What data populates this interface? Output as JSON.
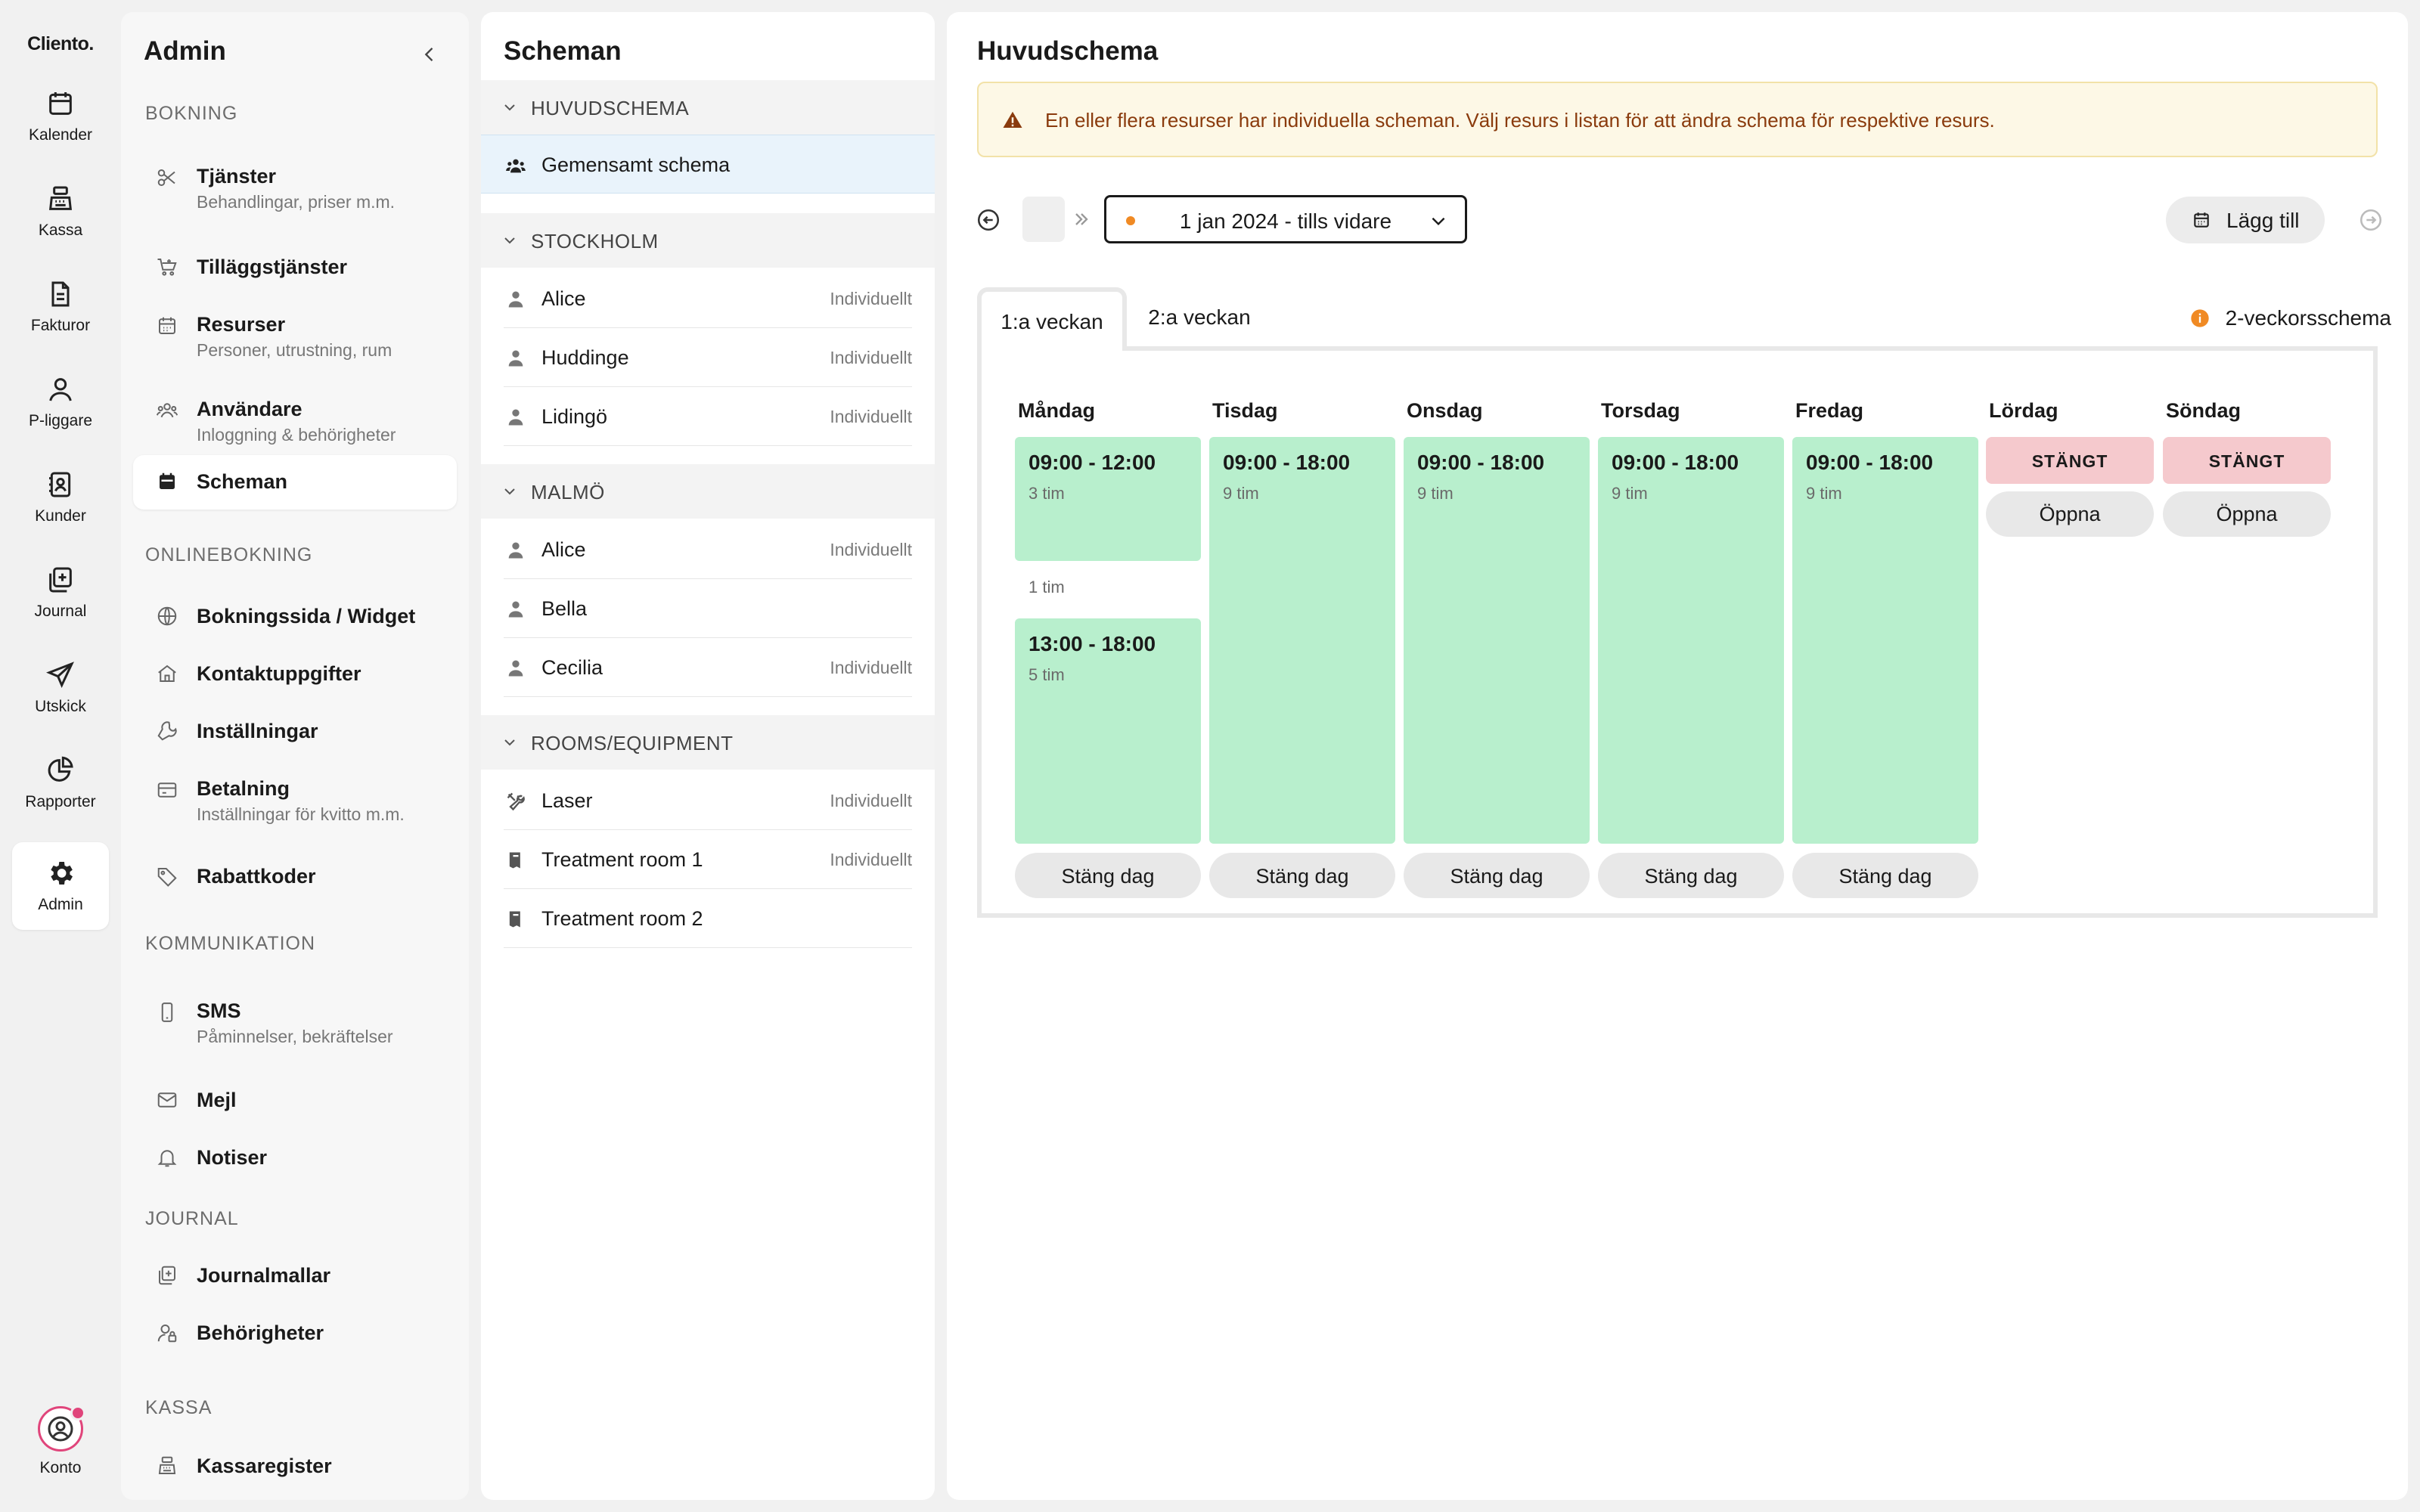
{
  "rail": {
    "logo": "Cliento.",
    "items": [
      {
        "label": "Kalender",
        "icon": "calendar-icon"
      },
      {
        "label": "Kassa",
        "icon": "cash-register-icon"
      },
      {
        "label": "Fakturor",
        "icon": "invoice-icon"
      },
      {
        "label": "P-liggare",
        "icon": "person-icon"
      },
      {
        "label": "Kunder",
        "icon": "contacts-icon"
      },
      {
        "label": "Journal",
        "icon": "journal-icon"
      },
      {
        "label": "Utskick",
        "icon": "send-icon"
      },
      {
        "label": "Rapporter",
        "icon": "pie-chart-icon"
      },
      {
        "label": "Admin",
        "icon": "gear-icon",
        "active": true
      }
    ],
    "account_label": "Konto"
  },
  "admin": {
    "title": "Admin",
    "sections": {
      "bokning": "BOKNING",
      "onlinebokning": "ONLINEBOKNING",
      "kommunikation": "KOMMUNIKATION",
      "journal": "JOURNAL",
      "kassa": "KASSA"
    },
    "items": {
      "tjanster": {
        "label": "Tjänster",
        "sub": "Behandlingar, priser m.m."
      },
      "tillagg": {
        "label": "Tilläggstjänster"
      },
      "resurser": {
        "label": "Resurser",
        "sub": "Personer, utrustning, rum"
      },
      "anvandare": {
        "label": "Användare",
        "sub": "Inloggning & behörigheter"
      },
      "scheman": {
        "label": "Scheman"
      },
      "bokningssida": {
        "label": "Bokningssida / Widget"
      },
      "kontakt": {
        "label": "Kontaktuppgifter"
      },
      "installningar": {
        "label": "Inställningar"
      },
      "betalning": {
        "label": "Betalning",
        "sub": "Inställningar för kvitto m.m."
      },
      "rabatt": {
        "label": "Rabattkoder"
      },
      "sms": {
        "label": "SMS",
        "sub": "Påminnelser, bekräftelser"
      },
      "mejl": {
        "label": "Mejl"
      },
      "notiser": {
        "label": "Notiser"
      },
      "journalmallar": {
        "label": "Journalmallar"
      },
      "behorigheter": {
        "label": "Behörigheter"
      },
      "kassaregister": {
        "label": "Kassaregister"
      }
    }
  },
  "scheman": {
    "title": "Scheman",
    "groups": [
      {
        "name": "HUVUDSCHEMA",
        "rows": [
          {
            "label": "Gemensamt schema",
            "tag": ""
          }
        ]
      },
      {
        "name": "STOCKHOLM",
        "rows": [
          {
            "label": "Alice",
            "tag": "Individuellt"
          },
          {
            "label": "Huddinge",
            "tag": "Individuellt"
          },
          {
            "label": "Lidingö",
            "tag": "Individuellt"
          }
        ]
      },
      {
        "name": "MALMÖ",
        "rows": [
          {
            "label": "Alice",
            "tag": "Individuellt"
          },
          {
            "label": "Bella",
            "tag": ""
          },
          {
            "label": "Cecilia",
            "tag": "Individuellt"
          }
        ]
      },
      {
        "name": "ROOMS/EQUIPMENT",
        "rows": [
          {
            "label": "Laser",
            "tag": "Individuellt"
          },
          {
            "label": "Treatment room 1",
            "tag": "Individuellt"
          },
          {
            "label": "Treatment room 2",
            "tag": ""
          }
        ]
      }
    ]
  },
  "main": {
    "title": "Huvudschema",
    "alert": "En eller flera resurser har individuella scheman. Välj resurs i listan för att ändra schema för respektive resurs.",
    "date_range": "1 jan 2024 - tills vidare",
    "add_label": "Lägg till",
    "tabs": [
      "1:a veckan",
      "2:a veckan"
    ],
    "biweek_label": "2-veckorsschema",
    "close_day_label": "Stäng dag",
    "closed_label": "STÄNGT",
    "open_label": "Öppna",
    "days": [
      {
        "name": "Måndag",
        "slots": [
          {
            "time": "09:00 - 12:00",
            "dur": "3 tim"
          },
          {
            "time": "13:00 - 18:00",
            "dur": "5 tim"
          }
        ],
        "gap": "1 tim"
      },
      {
        "name": "Tisdag",
        "slots": [
          {
            "time": "09:00 - 18:00",
            "dur": "9 tim"
          }
        ]
      },
      {
        "name": "Onsdag",
        "slots": [
          {
            "time": "09:00 - 18:00",
            "dur": "9 tim"
          }
        ]
      },
      {
        "name": "Torsdag",
        "slots": [
          {
            "time": "09:00 - 18:00",
            "dur": "9 tim"
          }
        ]
      },
      {
        "name": "Fredag",
        "slots": [
          {
            "time": "09:00 - 18:00",
            "dur": "9 tim"
          }
        ]
      },
      {
        "name": "Lördag",
        "closed": true
      },
      {
        "name": "Söndag",
        "closed": true
      }
    ]
  }
}
